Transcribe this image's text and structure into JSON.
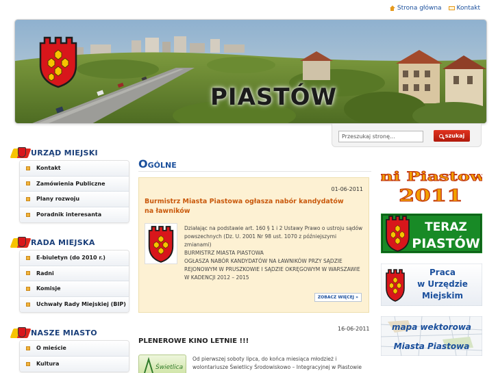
{
  "toplinks": {
    "home": "Strona główna",
    "contact": "Kontakt"
  },
  "banner": {
    "title": "PIASTÓW"
  },
  "search": {
    "placeholder": "Przeszukaj stronę...",
    "value": "Przeszukaj stronę...",
    "button": "szukaj"
  },
  "nav": [
    {
      "title": "URZĄD MIEJSKI",
      "items": [
        "Kontakt",
        "Zamówienia Publiczne",
        "Plany rozwoju",
        "Poradnik interesanta"
      ]
    },
    {
      "title": "RADA MIEJSKA",
      "items": [
        "E-biuletyn (do 2010 r.)",
        "Radni",
        "Komisje",
        "Uchwały Rady Miejskiej (BIP)"
      ]
    },
    {
      "title": "NASZE MIASTO",
      "items": [
        "O mieście",
        "Kultura"
      ]
    }
  ],
  "main": {
    "title": "Ogólne",
    "news": [
      {
        "date": "01-06-2011",
        "title": "Burmistrz Miasta Piastowa ogłasza nabór kandydatów na ławników",
        "body1": "Działając na podstawie art. 160 § 1 i 2 Ustawy Prawo o ustroju sądów powszechnych (Dz. U. 2001 Nr 98 ust. 1070 z późniejszymi zmianami)",
        "body2": "BURMISTRZ MIASTA PIASTOWA",
        "body3": "OGŁASZA NABÓR KANDYDATÓW NA ŁAWNIKÓW PRZY SĄDZIE REJONOWYM W PRUSZKOWIE I SĄDZIE OKRĘGOWYM W WARSZAWIE W KADENCJI 2012 – 2015",
        "more": "ZOBACZ WIĘCEJ »"
      },
      {
        "date": "16-06-2011",
        "title": "PLENEROWE KINO LETNIE !!!",
        "body": "Od pierwszej soboty lipca, do końca miesiąca młodzież i wolontariusze Świetlicy Środowiskowo – Integracyjnej w Piastowie",
        "thumb_text": "Świetlica"
      }
    ]
  },
  "sidebar": {
    "dni": {
      "line1": "Dni Piastowa",
      "line2": "2011"
    },
    "teraz": {
      "line1": "TERAZ",
      "line2": "PIASTÓW"
    },
    "praca": {
      "line1": "Praca",
      "line2": "w Urzędzie",
      "line3": "Miejskim"
    },
    "mapa": {
      "line1": "mapa wektorowa",
      "line2": "Miasta Piastowa"
    }
  },
  "colors": {
    "accent": "#1a4f9c",
    "news_title": "#c9590c",
    "shield_red": "#d8161b",
    "shield_yellow": "#f7c400",
    "news_bg": "#fdf1d3"
  }
}
